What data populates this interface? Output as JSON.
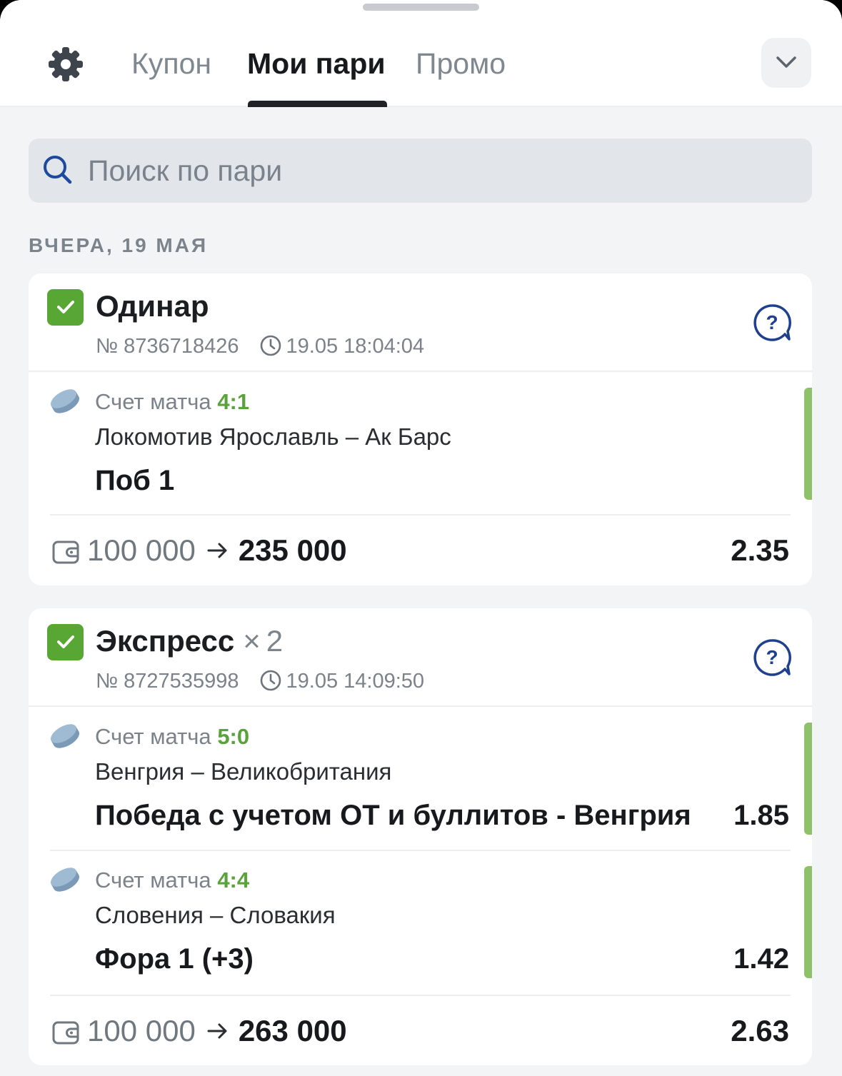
{
  "header": {
    "tabs": [
      {
        "label": "Купон",
        "active": false
      },
      {
        "label": "Мои пари",
        "active": true
      },
      {
        "label": "Промо",
        "active": false
      }
    ]
  },
  "search": {
    "placeholder": "Поиск по пари"
  },
  "date_header": "ВЧЕРА, 19 МАЯ",
  "bets": [
    {
      "type": "Одинар",
      "number": "№ 8736718426",
      "time": "19.05 18:04:04",
      "events": [
        {
          "label": "Счет матча",
          "score": "4:1",
          "teams": "Локомотив Ярославль – Ак Барс",
          "outcome": "Поб 1",
          "odd": ""
        }
      ],
      "stake": "100 000",
      "payout": "235 000",
      "total_odd": "2.35"
    },
    {
      "type": "Экспресс",
      "multiplier_sign": "×",
      "multiplier": "2",
      "number": "№ 8727535998",
      "time": "19.05 14:09:50",
      "events": [
        {
          "label": "Счет матча",
          "score": "5:0",
          "teams": "Венгрия – Великобритания",
          "outcome": "Победа с учетом ОТ и буллитов - Венгрия",
          "odd": "1.85"
        },
        {
          "label": "Счет матча",
          "score": "4:4",
          "teams": "Словения – Словакия",
          "outcome": "Фора 1 (+3)",
          "odd": "1.42"
        }
      ],
      "stake": "100 000",
      "payout": "263 000",
      "total_odd": "2.63"
    }
  ],
  "colors": {
    "accent_green": "#58a634",
    "score_green": "#5aa33a",
    "status_bar": "#8fc06a",
    "help_blue": "#1f3f8f"
  },
  "icons": [
    "gear-icon",
    "chevron-down-icon",
    "search-icon",
    "check-icon",
    "clock-icon",
    "help-icon",
    "hockey-puck-icon",
    "wallet-icon",
    "arrow-right-icon"
  ]
}
